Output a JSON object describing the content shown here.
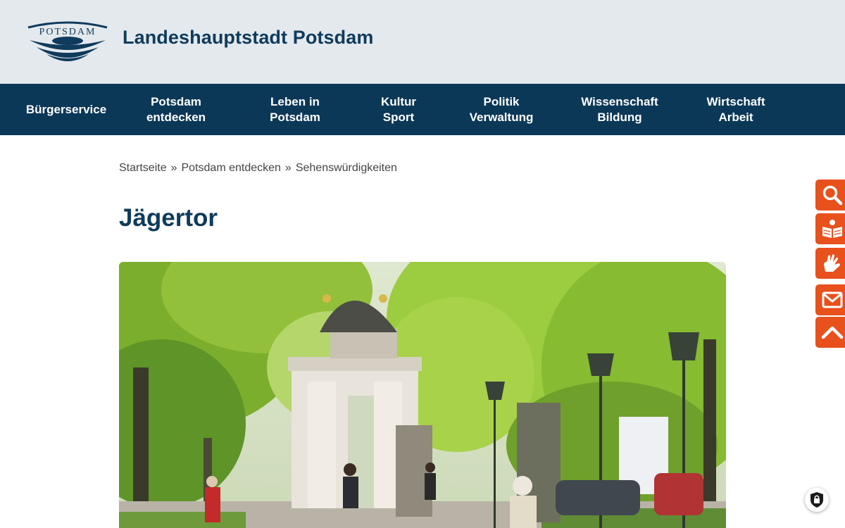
{
  "header": {
    "logo_text": "POTSDAM",
    "site_title": "Landeshauptstadt Potsdam"
  },
  "nav": {
    "items": [
      {
        "line1": "Bürgerservice",
        "line2": ""
      },
      {
        "line1": "Potsdam",
        "line2": "entdecken"
      },
      {
        "line1": "Leben in",
        "line2": "Potsdam"
      },
      {
        "line1": "Kultur",
        "line2": "Sport"
      },
      {
        "line1": "Politik",
        "line2": "Verwaltung"
      },
      {
        "line1": "Wissenschaft",
        "line2": "Bildung"
      },
      {
        "line1": "Wirtschaft",
        "line2": "Arbeit"
      }
    ]
  },
  "breadcrumb": {
    "items": [
      "Startseite",
      "Potsdam entdecken",
      "Sehenswürdigkeiten"
    ],
    "separator": "»"
  },
  "page": {
    "title": "Jägertor"
  },
  "side_tools": [
    {
      "icon": "search-icon"
    },
    {
      "icon": "easy-language-book-icon"
    },
    {
      "icon": "sign-language-hands-icon"
    },
    {
      "icon": "mail-icon"
    },
    {
      "icon": "chevron-up-icon"
    }
  ],
  "colors": {
    "header_bg": "#e4e9ee",
    "nav_bg": "#0c3857",
    "title_blue": "#0f3b5c",
    "accent_orange": "#e8501c"
  }
}
